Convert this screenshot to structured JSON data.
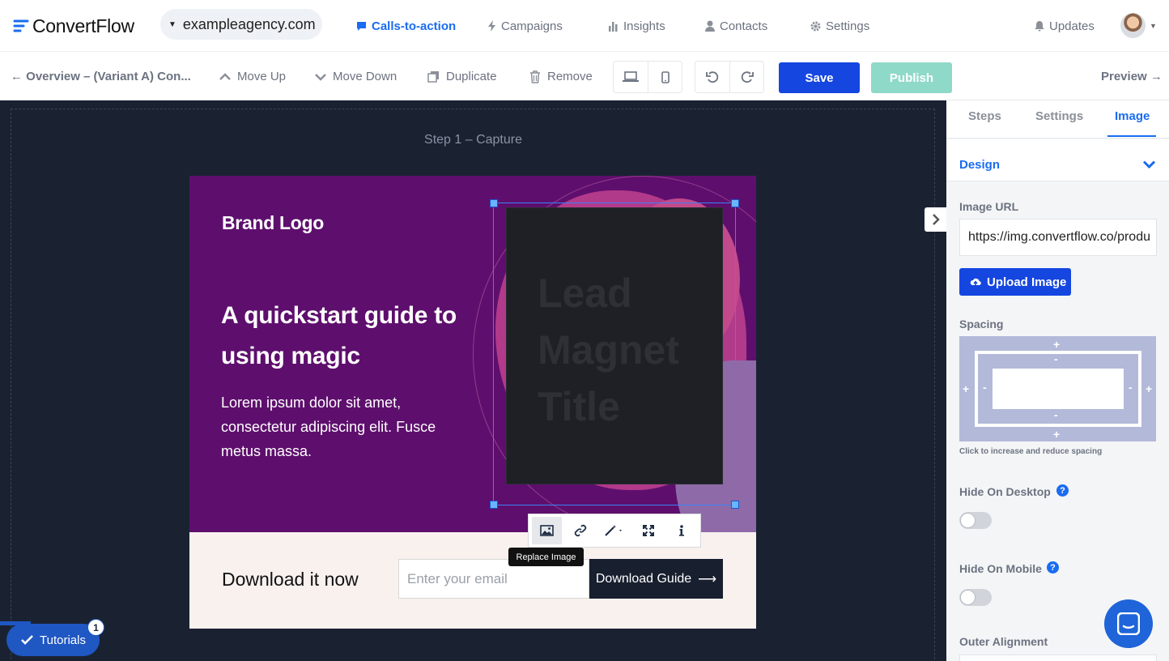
{
  "app": {
    "name": "ConvertFlow"
  },
  "domain_selector": {
    "value": "exampleagency.com"
  },
  "nav": {
    "items": [
      {
        "label": "Calls-to-action",
        "icon": "chat-icon",
        "active": true
      },
      {
        "label": "Campaigns",
        "icon": "bolt-icon"
      },
      {
        "label": "Insights",
        "icon": "bar-chart-icon"
      },
      {
        "label": "Contacts",
        "icon": "user-icon"
      },
      {
        "label": "Settings",
        "icon": "gear-icon"
      }
    ],
    "updates": "Updates"
  },
  "toolbar": {
    "breadcrumb": "← Overview – (Variant A) Con...",
    "move_up": "Move Up",
    "move_down": "Move Down",
    "duplicate": "Duplicate",
    "remove": "Remove",
    "save": "Save",
    "publish": "Publish",
    "preview": "Preview →"
  },
  "canvas": {
    "step_label": "Step 1 – Capture",
    "cta": {
      "brand_logo": "Brand Logo",
      "headline": "A quickstart guide to using magic",
      "body": "Lorem ipsum dolor sit amet, consectetur adipiscing elit. Fusce metus massa.",
      "book_title": "Lead Magnet Title",
      "download_text": "Download it now",
      "email_placeholder": "Enter your email",
      "download_button": "Download Guide"
    },
    "image_toolbar_tooltip": "Replace Image"
  },
  "tutorials": {
    "label": "Tutorials",
    "badge": "1"
  },
  "panel": {
    "tabs": [
      {
        "label": "Steps"
      },
      {
        "label": "Settings"
      },
      {
        "label": "Image",
        "active": true
      }
    ],
    "section": "Design",
    "image_url_label": "Image URL",
    "image_url_value": "https://img.convertflow.co/produ",
    "upload_button": "Upload Image",
    "spacing_label": "Spacing",
    "spacing_hint": "Click to increase and reduce spacing",
    "hide_desktop": "Hide On Desktop",
    "hide_mobile": "Hide On Mobile",
    "outer_alignment": "Outer Alignment"
  },
  "colors": {
    "accent": "#1a6cf0",
    "save": "#1546e0",
    "publish": "#8fd9c9",
    "canvas_bg": "#1a2232",
    "cta_purple": "#5e0f6d"
  }
}
